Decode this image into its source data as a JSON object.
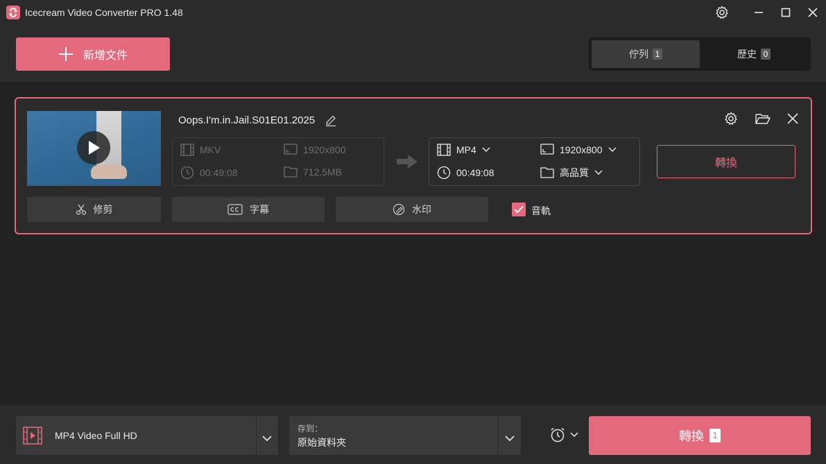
{
  "app": {
    "title": "Icecream Video Converter PRO 1.48"
  },
  "header": {
    "add_file_label": "新增文件",
    "tabs": [
      {
        "label": "佇列",
        "count": "1"
      },
      {
        "label": "歷史",
        "count": "0"
      }
    ]
  },
  "item": {
    "filename": "Oops.I'm.in.Jail.S01E01.2025",
    "source": {
      "format": "MKV",
      "resolution": "1920x800",
      "duration": "00:49:08",
      "size": "712.5MB"
    },
    "target": {
      "format": "MP4",
      "resolution": "1920x800",
      "duration": "00:49:08",
      "quality": "高品質"
    },
    "convert_label": "轉換",
    "tools": {
      "trim": "修剪",
      "subtitles": "字幕",
      "watermark": "水印",
      "audio": "音軌"
    }
  },
  "footer": {
    "preset": "MP4 Video Full HD",
    "save_to_caption": "存到：",
    "save_to_value": "原始資料夾",
    "convert_label": "轉換",
    "convert_count": "1"
  },
  "colors": {
    "accent": "#e4697c",
    "background": "#222222",
    "panel": "#2b2b2b"
  }
}
